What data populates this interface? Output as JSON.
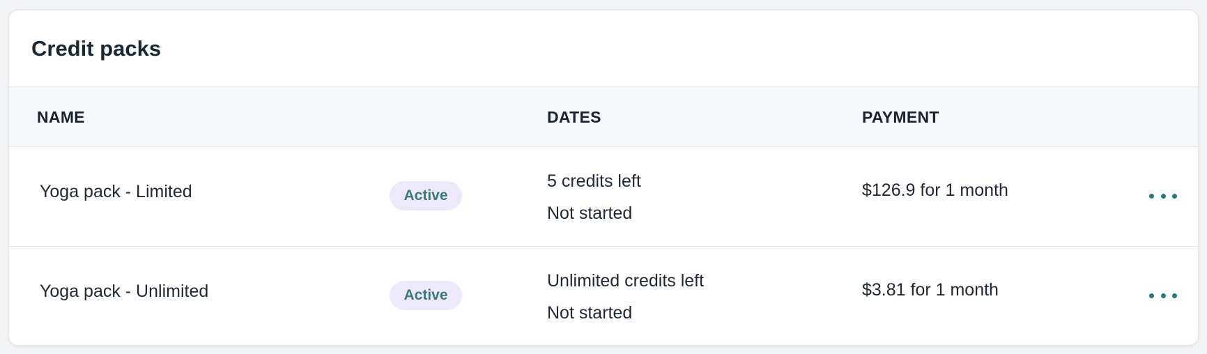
{
  "card": {
    "title": "Credit packs"
  },
  "table": {
    "headers": {
      "name": "NAME",
      "dates": "DATES",
      "payment": "PAYMENT"
    },
    "rows": [
      {
        "name": "Yoga pack - Limited",
        "status": "Active",
        "credits": "5 credits left",
        "start": "Not started",
        "payment": "$126.9 for 1 month",
        "actions_icon": "more-horizontal-icon"
      },
      {
        "name": "Yoga pack - Unlimited",
        "status": "Active",
        "credits": "Unlimited credits left",
        "start": "Not started",
        "payment": "$3.81 for 1 month",
        "actions_icon": "more-horizontal-icon"
      }
    ]
  },
  "colors": {
    "badge_bg": "#ede9fb",
    "badge_text": "#3a7a78",
    "accent": "#2f7677",
    "header_bg": "#f7f8fb"
  }
}
